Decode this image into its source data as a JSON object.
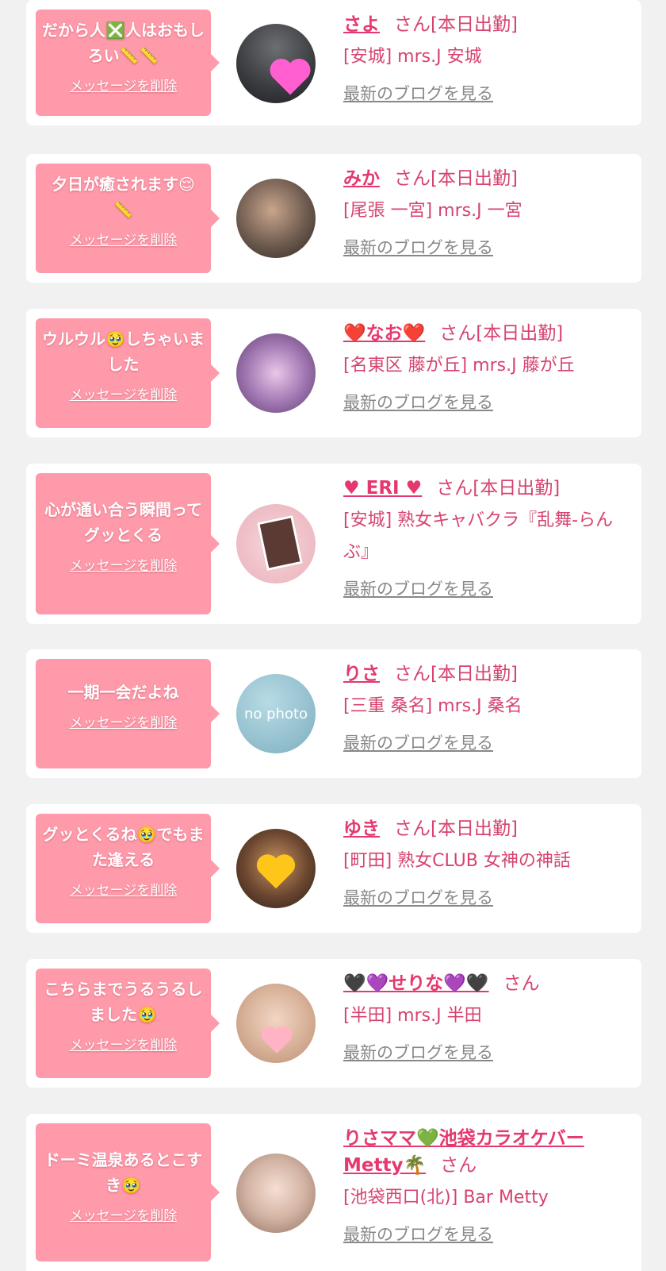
{
  "common": {
    "delete_label": "メッセージを削除",
    "blog_label": "最新のブログを見る",
    "san": "さん[本日出勤]",
    "san_plain": "さん"
  },
  "cards": [
    {
      "message": "だから人❎人はおもしろい📏📏",
      "name": "さよ",
      "shop": "[安城] mrs.J 安城"
    },
    {
      "message": "夕日が癒されます😌📏",
      "name": "みか",
      "shop": "[尾張 一宮] mrs.J 一宮"
    },
    {
      "message": "ウルウル🥹しちゃいました",
      "name": "❤️なお❤️",
      "shop": "[名東区 藤が丘] mrs.J 藤が丘"
    },
    {
      "message": "心が通い合う瞬間ってグッとくる",
      "name": "♥ ERI ♥",
      "shop": "[安城] 熟女キャバクラ『乱舞-らんぶ』"
    },
    {
      "message": "一期一会だよね",
      "name": "りさ",
      "shop": "[三重 桑名] mrs.J 桑名",
      "avatar_text": "no photo"
    },
    {
      "message": "グッとくるね🥹でもまた逢える",
      "name": "ゆき",
      "shop": "[町田] 熟女CLUB 女神の神話"
    },
    {
      "message": "こちらまでうるうるしました🥹",
      "name": "🖤💜せりな💜🖤",
      "shop": "[半田] mrs.J 半田"
    },
    {
      "message": "ドーミ温泉あるとこすき🥹",
      "name": "りさママ💚池袋カラオケバーMetty🌴",
      "shop": "[池袋西口(北)] Bar Metty"
    }
  ],
  "colors": {
    "bubble": "#fe9aa9",
    "name": "#e4396e",
    "text": "#d6436e",
    "link_gray": "#888888",
    "background": "#f1f1f1"
  }
}
